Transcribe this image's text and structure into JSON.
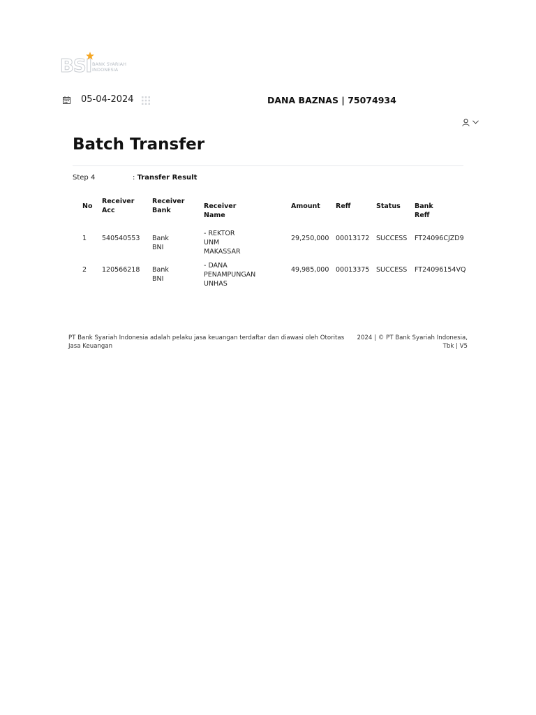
{
  "logo": {
    "brand": "BSI",
    "tagline_line1": "BANK SYARIAH",
    "tagline_line2": "INDONESIA",
    "star_color": "#f5a623"
  },
  "header": {
    "date": "05-04-2024",
    "account_title": "DANA BAZNAS | 75074934",
    "icons": [
      "calendar-icon",
      "apps-grid-icon",
      "user-icon",
      "chevron-down-icon"
    ]
  },
  "page": {
    "title": "Batch Transfer",
    "step_label": "Step 4",
    "step_separator": ":",
    "step_value": "Transfer Result"
  },
  "table": {
    "headers": {
      "no": "No",
      "acc_1": "Receiver",
      "acc_2": "Acc",
      "bank_1": "Receiver",
      "bank_2": "Bank",
      "name": "Receiver Name",
      "amount": "Amount",
      "reff": "Reff",
      "status": "Status",
      "bank_reff": "Bank Reff"
    },
    "rows": [
      {
        "no": "1",
        "acc": "540540553",
        "bank": "Bank BNI",
        "name_1": "- REKTOR UNM",
        "name_2": "MAKASSAR",
        "amount": "29,250,000",
        "reff": "00013172",
        "status": "SUCCESS",
        "bank_reff": "FT24096CJZD9"
      },
      {
        "no": "2",
        "acc": "120566218",
        "bank": "Bank BNI",
        "name_1": "- DANA PENAMPUNGAN",
        "name_2": "UNHAS",
        "amount": "49,985,000",
        "reff": "00013375",
        "status": "SUCCESS",
        "bank_reff": "FT24096154VQ"
      }
    ]
  },
  "footer": {
    "left_line1": "PT Bank Syariah Indonesia adalah pelaku jasa keuangan terdaftar dan diawasi oleh Otoritas",
    "left_line2": "Jasa Keuangan",
    "right_line1": "2024 | © PT Bank Syariah Indonesia,",
    "right_line2": "Tbk | V5"
  }
}
